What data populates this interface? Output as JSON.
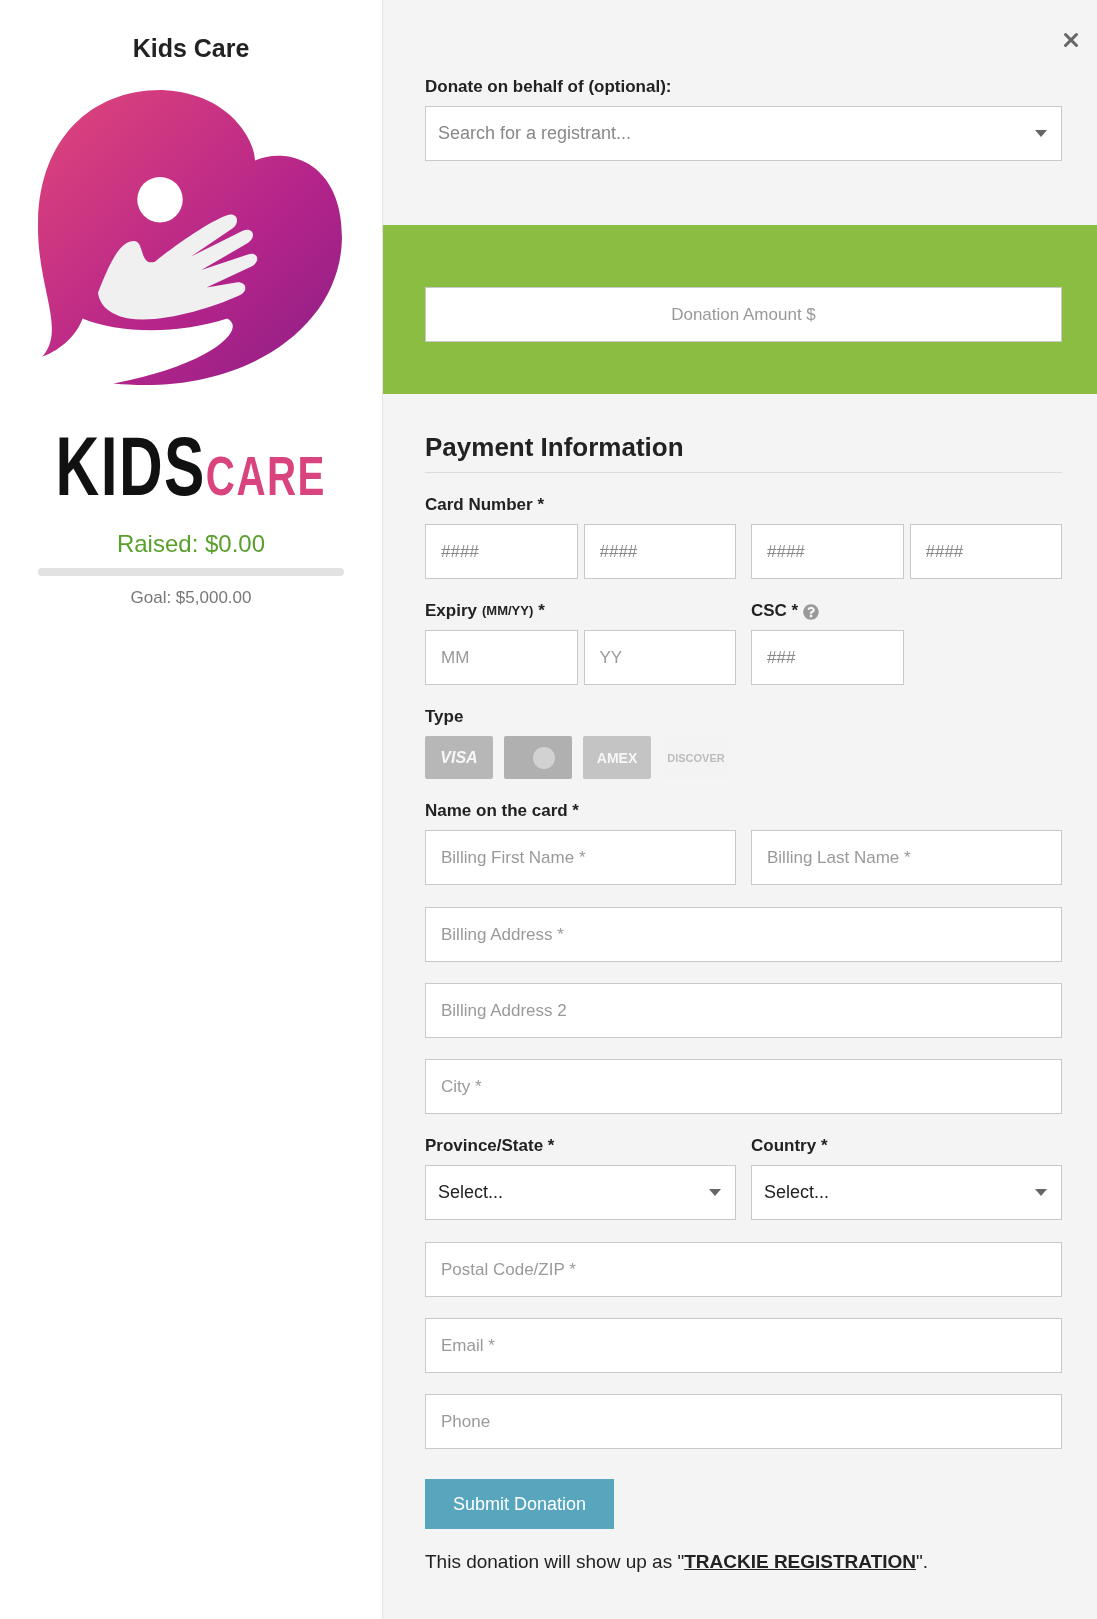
{
  "sidebar": {
    "title": "Kids Care",
    "wordmark": {
      "first": "KIDS",
      "second": "CARE"
    },
    "raised": "Raised: $0.00",
    "progress": {
      "level": 0
    },
    "goal": "Goal: $5,000.00"
  },
  "behalf": {
    "label": "Donate on behalf of (optional):",
    "placeholder": "Search for a registrant..."
  },
  "amount": {
    "placeholder": "Donation Amount $"
  },
  "payment": {
    "heading": "Payment Information",
    "card_number": {
      "label": "Card Number *",
      "placeholders": [
        "####",
        "####",
        "####",
        "####"
      ]
    },
    "expiry": {
      "label": "Expiry",
      "note": "(MM/YY)",
      "mark": "*",
      "placeholders": [
        "MM",
        "YY"
      ]
    },
    "csc": {
      "label": "CSC *",
      "placeholder": "###"
    },
    "card_type": {
      "label": "Type",
      "cards": [
        {
          "kind": "visa",
          "text": "VISA",
          "selected": false
        },
        {
          "kind": "mastercard",
          "selected": false
        },
        {
          "kind": "amex",
          "text": "AMEX",
          "selected": false
        },
        {
          "kind": "discover",
          "text": "DISCOVER",
          "selected": false
        }
      ]
    },
    "name": {
      "label": "Name on the card *",
      "placeholders": [
        "Billing First Name *",
        "Billing Last Name *"
      ]
    },
    "address_fields": [
      {
        "placeholder": "Billing Address *"
      },
      {
        "placeholder": "Billing Address 2"
      },
      {
        "placeholder": "City *"
      }
    ],
    "region": [
      {
        "label": "Province/State *",
        "value": "Select..."
      },
      {
        "label": "Country *",
        "value": "Select..."
      }
    ],
    "contact_fields": [
      {
        "placeholder": "Postal Code/ZIP *"
      },
      {
        "placeholder": "Email *"
      },
      {
        "placeholder": "Phone"
      }
    ]
  },
  "submit": "Submit Donation",
  "note": {
    "before": "This donation will show up as \"",
    "link": "TRACKIE REGISTRATION",
    "after": "\"."
  }
}
